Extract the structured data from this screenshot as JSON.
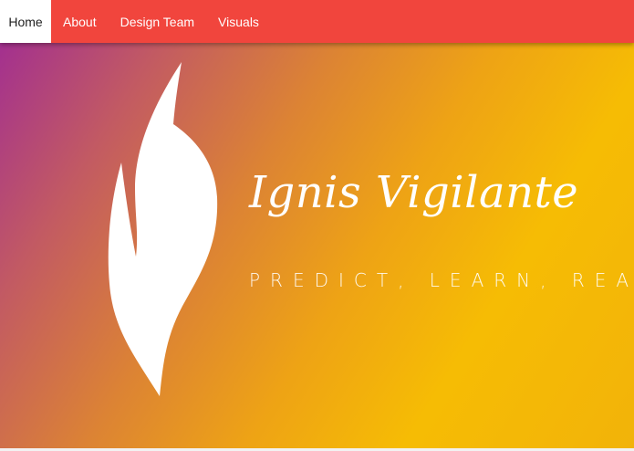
{
  "nav": {
    "items": [
      {
        "label": "Home",
        "active": true
      },
      {
        "label": "About",
        "active": false
      },
      {
        "label": "Design Team",
        "active": false
      },
      {
        "label": "Visuals",
        "active": false
      }
    ]
  },
  "hero": {
    "title": "Ignis Vigilante",
    "tagline": "PREDICT, LEARN, REACT",
    "logo_icon": "flame-icon"
  },
  "colors": {
    "navbar": "#f1453d",
    "gradient_start": "#a3308f",
    "gradient_end": "#f6bc04",
    "text_light": "#ffffff"
  }
}
